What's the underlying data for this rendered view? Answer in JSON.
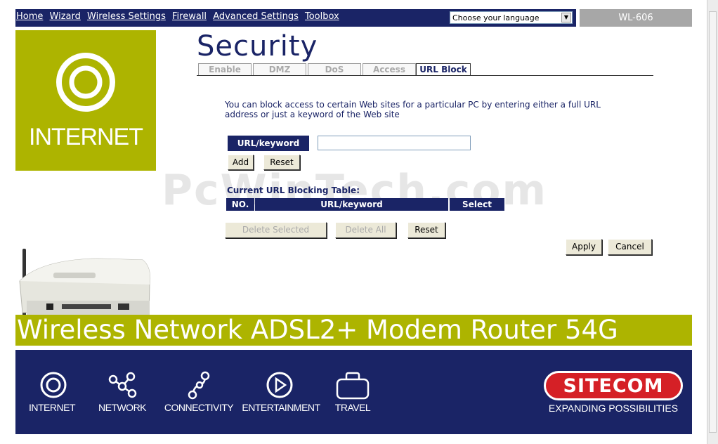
{
  "nav": {
    "links": [
      "Home",
      "Wizard",
      "Wireless Settings",
      "Firewall",
      "Advanced Settings",
      "Toolbox"
    ],
    "language_select": "Choose your language",
    "model": "WL-606"
  },
  "tile": {
    "label": "INTERNET"
  },
  "page": {
    "title": "Security"
  },
  "tabs": [
    {
      "label": "Enable",
      "active": false
    },
    {
      "label": "DMZ",
      "active": false
    },
    {
      "label": "DoS",
      "active": false
    },
    {
      "label": "Access",
      "active": false
    },
    {
      "label": "URL Block",
      "active": true
    }
  ],
  "form": {
    "description": "You can block access to certain Web sites for a particular PC by entering either a full URL address or just a keyword of the Web site",
    "url_label": "URL/keyword",
    "url_value": "",
    "add_label": "Add",
    "reset_label": "Reset"
  },
  "table": {
    "title": "Current URL Blocking Table:",
    "headers": [
      "NO.",
      "URL/keyword",
      "Select"
    ],
    "rows": []
  },
  "actions": {
    "delete_selected": "Delete Selected",
    "delete_all": "Delete All",
    "reset": "Reset",
    "apply": "Apply",
    "cancel": "Cancel"
  },
  "watermark": "PcWinTech.com",
  "banner": "Wireless Network ADSL2+ Modem Router 54G",
  "footer": {
    "items": [
      "INTERNET",
      "NETWORK",
      "CONNECTIVITY",
      "ENTERTAINMENT",
      "TRAVEL"
    ],
    "brand": "SITECOM",
    "slogan": "EXPANDING POSSIBILITIES"
  },
  "colors": {
    "navy": "#1a2466",
    "olive": "#adb400",
    "brand_red": "#d52026"
  }
}
